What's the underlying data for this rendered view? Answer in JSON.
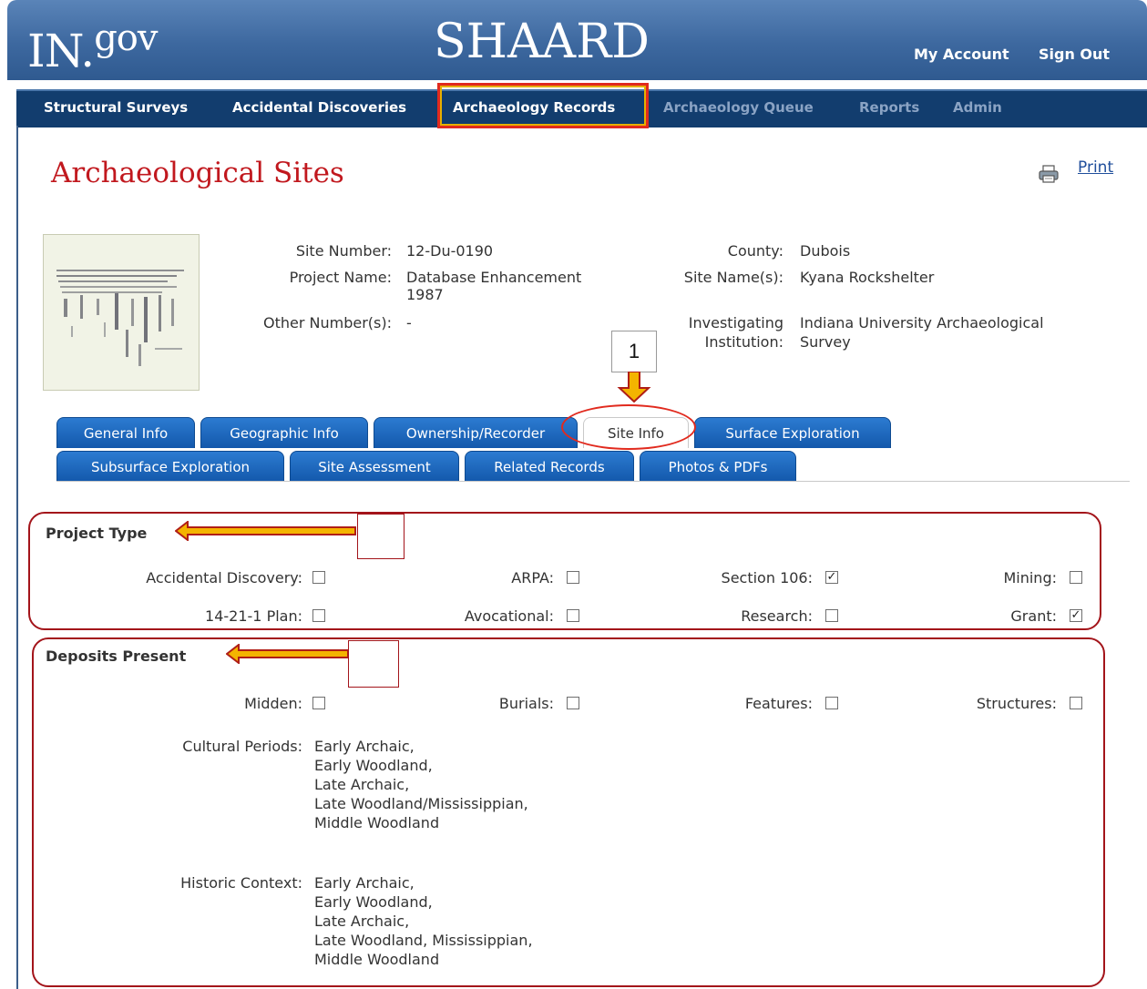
{
  "header": {
    "logo_main": "IN.",
    "logo_gov": "gov",
    "app_title": "SHAARD",
    "my_account": "My Account",
    "sign_out": "Sign Out"
  },
  "nav": {
    "items": [
      {
        "label": "Structural Surveys",
        "enabled": true
      },
      {
        "label": "Accidental Discoveries",
        "enabled": true
      },
      {
        "label": "Archaeology Records",
        "enabled": true,
        "selected": true
      },
      {
        "label": "Archaeology Queue",
        "enabled": false
      },
      {
        "label": "Reports",
        "enabled": false
      },
      {
        "label": "Admin",
        "enabled": false
      }
    ]
  },
  "page": {
    "title": "Archaeological Sites",
    "print_label": "Print"
  },
  "record": {
    "site_number_label": "Site Number:",
    "site_number": "12-Du-0190",
    "project_name_label": "Project Name:",
    "project_name_line1": "Database Enhancement",
    "project_name_line2": "1987",
    "other_numbers_label": "Other Number(s):",
    "other_numbers": "-",
    "county_label": "County:",
    "county": "Dubois",
    "site_names_label": "Site Name(s):",
    "site_names": "Kyana Rockshelter",
    "inv_inst_label_line1": "Investigating",
    "inv_inst_label_line2": "Institution:",
    "inv_inst_line1": "Indiana University Archaeological",
    "inv_inst_line2": "Survey"
  },
  "callout": {
    "number": "1"
  },
  "tabs": {
    "row1": [
      "General Info",
      "Geographic Info",
      "Ownership/Recorder",
      "Site Info",
      "Surface Exploration"
    ],
    "row2": [
      "Subsurface Exploration",
      "Site Assessment",
      "Related Records",
      "Photos & PDFs"
    ],
    "active": "Site Info"
  },
  "project_type": {
    "title": "Project Type",
    "items": [
      {
        "label": "Accidental Discovery:",
        "checked": false
      },
      {
        "label": "ARPA:",
        "checked": false
      },
      {
        "label": "Section 106:",
        "checked": true
      },
      {
        "label": "Mining:",
        "checked": false
      },
      {
        "label": "14-21-1 Plan:",
        "checked": false
      },
      {
        "label": "Avocational:",
        "checked": false
      },
      {
        "label": "Research:",
        "checked": false
      },
      {
        "label": "Grant:",
        "checked": true
      }
    ]
  },
  "deposits": {
    "title": "Deposits Present",
    "items": [
      {
        "label": "Midden:",
        "checked": false
      },
      {
        "label": "Burials:",
        "checked": false
      },
      {
        "label": "Features:",
        "checked": false
      },
      {
        "label": "Structures:",
        "checked": false
      }
    ],
    "cultural_periods_label": "Cultural Periods:",
    "cultural_periods": [
      "Early Archaic,",
      "Early Woodland,",
      "Late Archaic,",
      "Late Woodland/Mississippian,",
      "Middle Woodland"
    ],
    "historic_context_label": "Historic Context:",
    "historic_context": [
      "Early Archaic,",
      "Early Woodland,",
      "Late Archaic,",
      "Late Woodland, Mississippian,",
      "Middle Woodland"
    ]
  },
  "colors": {
    "header_blue": "#3d689f",
    "nav_navy": "#123d6e",
    "title_red": "#c1181e",
    "tab_blue": "#1c69c0",
    "annotation_red": "#a3141a",
    "annotation_gold": "#f4b400"
  },
  "icons": {
    "print": "printer-icon",
    "arrow": "arrow-annotation"
  }
}
